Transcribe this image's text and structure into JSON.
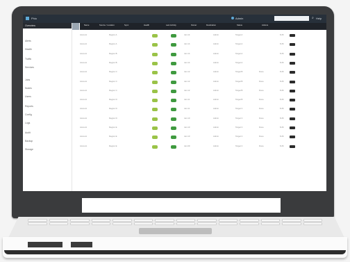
{
  "app": {
    "title": "Phio",
    "user": "Admin",
    "search_placeholder": "",
    "help_label": "Help"
  },
  "nav": {
    "header": "Overview",
    "items": [
      "Alerts",
      "Health",
      "Traffic",
      "Services",
      "Jobs",
      "Nodes",
      "Users",
      "Reports",
      "Config",
      "Logs",
      "Audit",
      "Backup",
      "Storage"
    ]
  },
  "table": {
    "columns": [
      "Name",
      "Source / Location",
      "Sync",
      "Health",
      "Last Activity",
      "Owner",
      "Destination",
      "Status",
      "Actions"
    ],
    "rows": [
      {
        "name": "Account",
        "source": "Region A",
        "updated": "Jan 14",
        "owner": "Admin",
        "dest": "Target A",
        "state": "",
        "val": "8.26"
      },
      {
        "name": "Account",
        "source": "Region A",
        "updated": "Jan 14",
        "owner": "Admin",
        "dest": "Target A",
        "state": "",
        "val": "8.26"
      },
      {
        "name": "Account",
        "source": "Region B",
        "updated": "Jan 14",
        "owner": "Admin",
        "dest": "Target A",
        "state": "",
        "val": "8.26"
      },
      {
        "name": "Account",
        "source": "Region B",
        "updated": "Jan 14",
        "owner": "Admin",
        "dest": "Target A",
        "state": "",
        "val": "8.26"
      },
      {
        "name": "Account",
        "source": "Region C",
        "updated": "Jan 12",
        "owner": "Admin",
        "dest": "Target B",
        "state": "Done",
        "val": "8.26"
      },
      {
        "name": "Account",
        "source": "Region C",
        "updated": "Jan 12",
        "owner": "Admin",
        "dest": "Target B",
        "state": "Done",
        "val": "8.26"
      },
      {
        "name": "Account",
        "source": "Region C",
        "updated": "Jan 12",
        "owner": "Admin",
        "dest": "Target B",
        "state": "Done",
        "val": "8.26"
      },
      {
        "name": "Account",
        "source": "Region D",
        "updated": "Jan 11",
        "owner": "Admin",
        "dest": "Target B",
        "state": "Done",
        "val": "8.26"
      },
      {
        "name": "Account",
        "source": "Region D",
        "updated": "Jan 11",
        "owner": "Admin",
        "dest": "Target C",
        "state": "Done",
        "val": "8.26"
      },
      {
        "name": "Account",
        "source": "Region D",
        "updated": "Jan 10",
        "owner": "Admin",
        "dest": "Target C",
        "state": "Done",
        "val": "8.26"
      },
      {
        "name": "Account",
        "source": "Region E",
        "updated": "Jan 10",
        "owner": "Admin",
        "dest": "Target C",
        "state": "Done",
        "val": "8.26"
      },
      {
        "name": "Account",
        "source": "Region E",
        "updated": "Jan 10",
        "owner": "Admin",
        "dest": "Target C",
        "state": "Done",
        "val": "8.26"
      },
      {
        "name": "Account",
        "source": "Region E",
        "updated": "Jan 09",
        "owner": "Admin",
        "dest": "Target C",
        "state": "Done",
        "val": "8.26"
      }
    ]
  },
  "colors": {
    "healthy": "#9ac347",
    "ok": "#3f9a3f",
    "header": "#1f2329"
  }
}
